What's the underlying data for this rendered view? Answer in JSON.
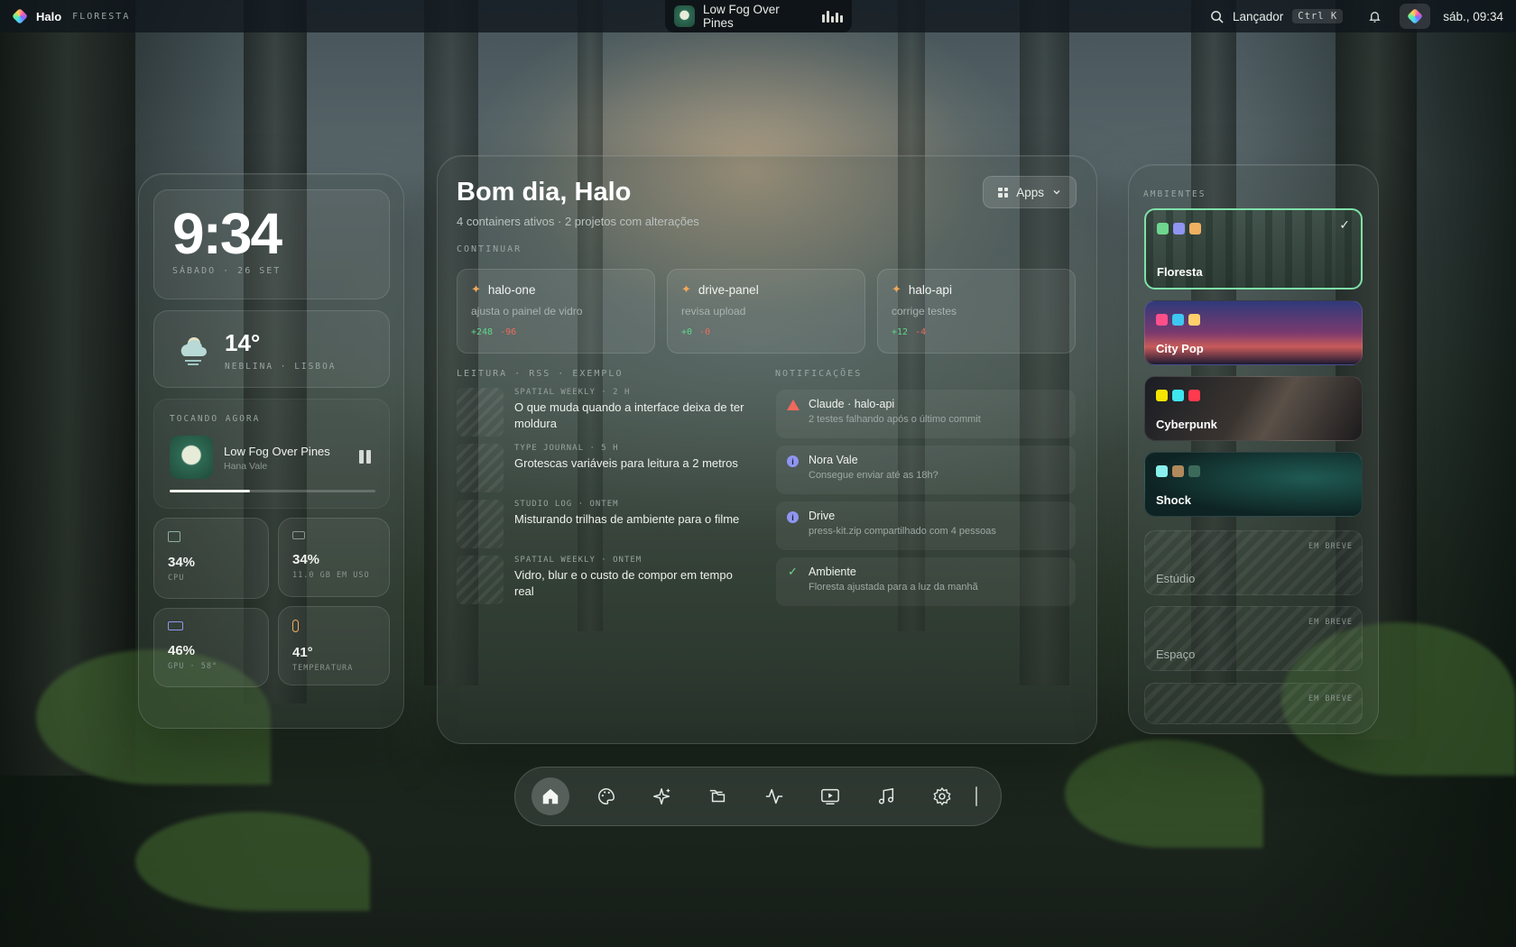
{
  "topbar": {
    "brand": "Halo",
    "workspace": "FLORESTA",
    "now_playing": "Low Fog Over Pines",
    "launcher_label": "Lançador",
    "launcher_shortcut": "Ctrl K",
    "datetime": "sáb., 09:34"
  },
  "left": {
    "clock": {
      "time": "9:34",
      "date": "SÁBADO · 26 SET"
    },
    "weather": {
      "temp": "14°",
      "desc": "NEBLINA · LISBOA",
      "icon": "cloud-sun-icon"
    },
    "player": {
      "label": "TOCANDO AGORA",
      "track": "Low Fog Over Pines",
      "artist": "Hana Vale",
      "progress": 0.39
    },
    "stats": [
      {
        "value": "34%",
        "label": "CPU",
        "icon": "cpu-icon"
      },
      {
        "value": "34%",
        "label": "11.0 GB EM USO",
        "icon": "memory-icon"
      },
      {
        "value": "46%",
        "label": "GPU · 58°",
        "icon": "gpu-icon"
      },
      {
        "value": "41°",
        "label": "TEMPERATURA",
        "icon": "thermometer-icon"
      }
    ]
  },
  "main": {
    "greeting": "Bom dia, Halo",
    "summary": "4 containers ativos · 2 projetos com alterações",
    "apps_label": "Apps",
    "continue_label": "CONTINUAR",
    "continue": [
      {
        "name": "halo-one",
        "desc": "ajusta o painel de vidro",
        "add": "+248",
        "del": "-96"
      },
      {
        "name": "drive-panel",
        "desc": "revisa upload",
        "add": "+0",
        "del": "-0"
      },
      {
        "name": "halo-api",
        "desc": "corrige testes",
        "add": "+12",
        "del": "-4"
      }
    ],
    "reading_label": "LEITURA · RSS · EXEMPLO",
    "reading": [
      {
        "meta": "SPATIAL WEEKLY · 2 H",
        "title": "O que muda quando a interface deixa de ter moldura"
      },
      {
        "meta": "TYPE JOURNAL · 5 H",
        "title": "Grotescas variáveis para leitura a 2 metros"
      },
      {
        "meta": "STUDIO LOG · ONTEM",
        "title": "Misturando trilhas de ambiente para o filme"
      },
      {
        "meta": "SPATIAL WEEKLY · ONTEM",
        "title": "Vidro, blur e o custo de compor em tempo real"
      }
    ],
    "notif_label": "NOTIFICAÇÕES",
    "notifications": [
      {
        "title": "Claude · halo-api",
        "sub": "2 testes falhando após o último commit",
        "kind": "warning",
        "color": "#ef6a5c"
      },
      {
        "title": "Nora Vale",
        "sub": "Consegue enviar até as 18h?",
        "kind": "info",
        "color": "#8f95f0"
      },
      {
        "title": "Drive",
        "sub": "press-kit.zip compartilhado com 4 pessoas",
        "kind": "info",
        "color": "#8f95f0"
      },
      {
        "title": "Ambiente",
        "sub": "Floresta ajustada para a luz da manhã",
        "kind": "success",
        "color": "#6fd68f"
      }
    ]
  },
  "right": {
    "label": "AMBIENTES",
    "environments": [
      {
        "name": "Floresta",
        "swatches": [
          "#6fd68f",
          "#8f95f0",
          "#f0b061"
        ],
        "selected": true
      },
      {
        "name": "City Pop",
        "swatches": [
          "#ff4f8b",
          "#3ec7f0",
          "#ffcf6b"
        ],
        "selected": false
      },
      {
        "name": "Cyberpunk",
        "swatches": [
          "#f5e400",
          "#3ee6f0",
          "#ff3a4f"
        ],
        "selected": false
      },
      {
        "name": "Shock",
        "swatches": [
          "#8af0ec",
          "#b08a5c",
          "#3c6a5a"
        ],
        "selected": false
      }
    ],
    "soon_badge": "EM BREVE",
    "soon": [
      "Estúdio",
      "Espaço",
      ""
    ]
  },
  "dock": [
    "home-icon",
    "palette-icon",
    "sparkles-icon",
    "folders-icon",
    "activity-icon",
    "video-icon",
    "music-icon",
    "settings-icon"
  ]
}
